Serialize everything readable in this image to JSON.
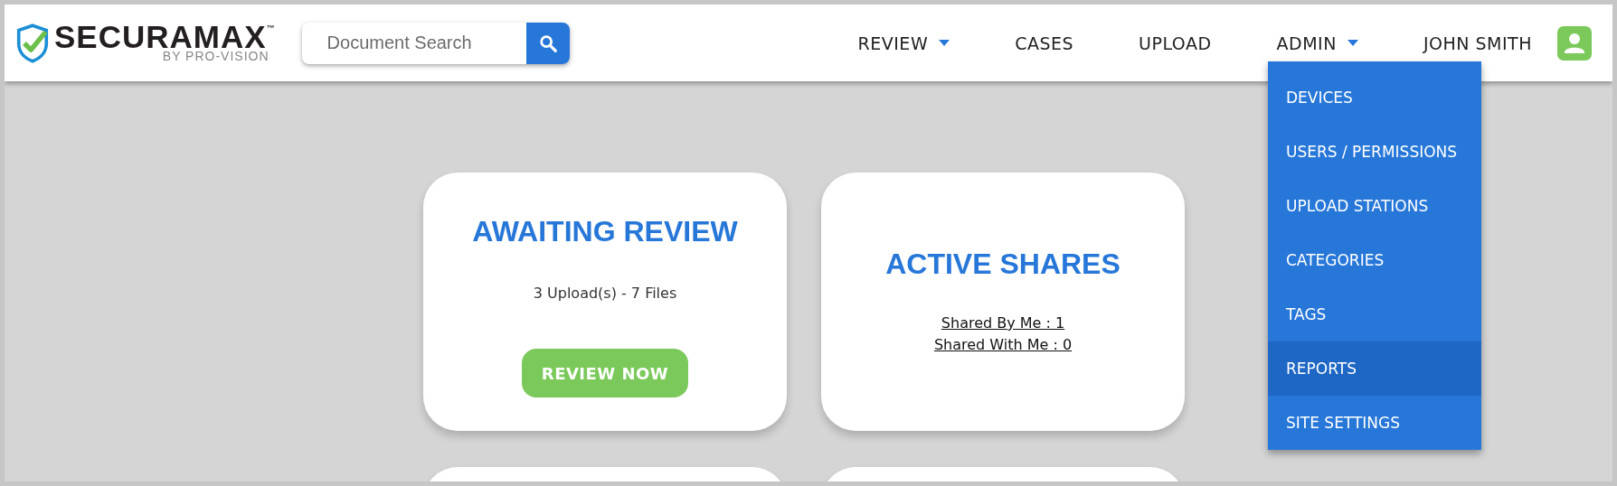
{
  "logo": {
    "name": "SECURAMAX",
    "trademark": "™",
    "tagline": "BY PRO-VISION"
  },
  "search": {
    "placeholder": "Document Search"
  },
  "nav": [
    {
      "label": "REVIEW",
      "has_caret": true
    },
    {
      "label": "CASES",
      "has_caret": false
    },
    {
      "label": "UPLOAD",
      "has_caret": false
    },
    {
      "label": "ADMIN",
      "has_caret": true
    }
  ],
  "user": {
    "name": "JOHN SMITH"
  },
  "admin_menu": {
    "expanded": true,
    "items": [
      {
        "label": "DEVICES",
        "selected": false
      },
      {
        "label": "USERS / PERMISSIONS",
        "selected": false
      },
      {
        "label": "UPLOAD STATIONS",
        "selected": false
      },
      {
        "label": "CATEGORIES",
        "selected": false
      },
      {
        "label": "TAGS",
        "selected": false
      },
      {
        "label": "REPORTS",
        "selected": true
      },
      {
        "label": "SITE SETTINGS",
        "selected": false
      }
    ]
  },
  "cards": [
    {
      "kind": "awaiting",
      "title": "AWAITING REVIEW",
      "summary": "3 Upload(s) - 7 Files",
      "button": "REVIEW NOW"
    },
    {
      "kind": "shares",
      "title": "ACTIVE SHARES",
      "links": [
        "Shared By Me : 1",
        "Shared With Me : 0"
      ]
    },
    {
      "kind": "partial"
    },
    {
      "kind": "partial"
    }
  ]
}
